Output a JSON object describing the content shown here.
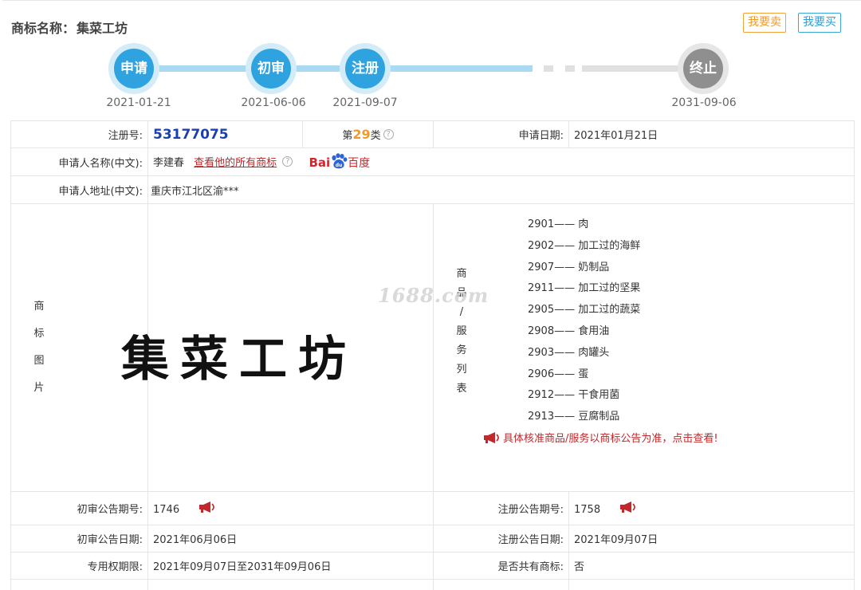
{
  "header": {
    "title_label": "商标名称：",
    "title_value": "集菜工坊",
    "sell_label": "我要卖",
    "buy_label": "我要买"
  },
  "timeline": [
    {
      "label": "申请",
      "date": "2021-01-21"
    },
    {
      "label": "初审",
      "date": "2021-06-06"
    },
    {
      "label": "注册",
      "date": "2021-09-07"
    },
    {
      "label": "终止",
      "date": "2031-09-06"
    }
  ],
  "info": {
    "reg_no_label": "注册号:",
    "reg_no": "53177075",
    "class_prefix": "第",
    "class_num": "29",
    "class_suffix": "类",
    "apply_date_label": "申请日期:",
    "apply_date": "2021年01月21日",
    "applicant_label": "申请人名称(中文):",
    "applicant": "李建春",
    "view_all_link": "查看他的所有商标",
    "baidu_latin": "Bai",
    "baidu_cn": "百度",
    "address_label": "申请人地址(中文):",
    "address": "重庆市江北区渝***",
    "image_label": [
      "商",
      "标",
      "图",
      "片"
    ],
    "trademark_text": "集菜工坊",
    "goods_label": [
      "商",
      "品",
      "/",
      "服",
      "务",
      "列",
      "表"
    ],
    "goods": [
      "2901—— 肉",
      "2902—— 加工过的海鲜",
      "2907—— 奶制品",
      "2911—— 加工过的坚果",
      "2905—— 加工过的蔬菜",
      "2908—— 食用油",
      "2903—— 肉罐头",
      "2906—— 蛋",
      "2912—— 干食用菌",
      "2913—— 豆腐制品"
    ],
    "goods_note": "具体核准商品/服务以商标公告为准，点击查看!",
    "prelim_no_label": "初审公告期号:",
    "prelim_no": "1746",
    "reg_pub_no_label": "注册公告期号:",
    "reg_pub_no": "1758",
    "prelim_date_label": "初审公告日期:",
    "prelim_date": "2021年06月06日",
    "reg_pub_date_label": "注册公告日期:",
    "reg_pub_date": "2021年09月07日",
    "term_label": "专用权期限:",
    "term": "2021年09月07日至2031年09月06日",
    "shared_label": "是否共有商标:",
    "shared": "否"
  },
  "watermark": "1688.com",
  "colors": {
    "accent_blue": "#2ea3e0",
    "accent_orange": "#f09a2b",
    "link_red": "#b8282a",
    "reg_no_blue": "#1c3fb0"
  },
  "icons": [
    "help-icon",
    "baidu-paw-icon",
    "megaphone-icon"
  ]
}
